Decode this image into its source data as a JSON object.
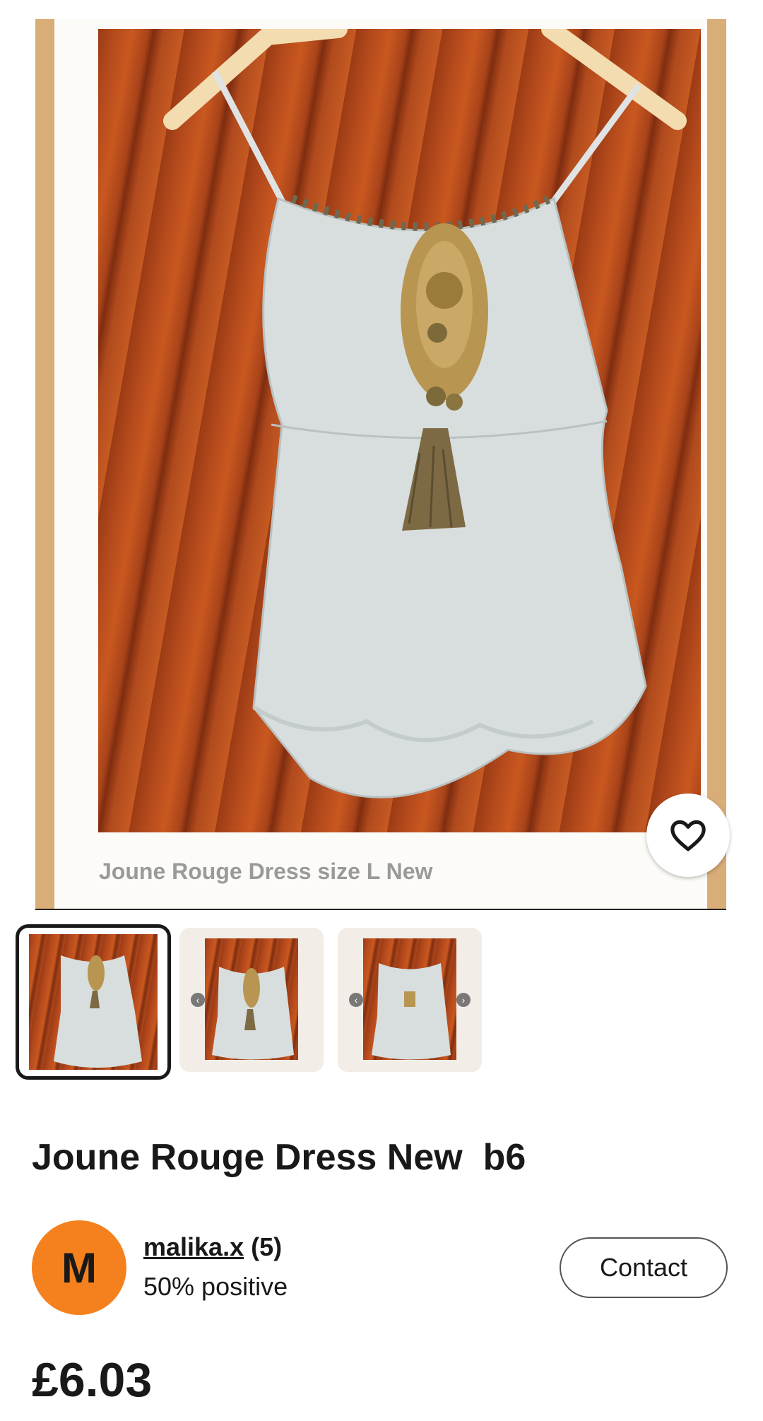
{
  "listing": {
    "image_caption": "Joune Rouge Dress size L New",
    "title": "Joune Rouge Dress New  b6",
    "price": "£6.03"
  },
  "gallery": {
    "image_count": 3,
    "selected_index": 0
  },
  "seller": {
    "avatar_initial": "M",
    "name": "malika.x",
    "score": "(5)",
    "feedback": "50% positive",
    "avatar_color": "#f5811e"
  },
  "actions": {
    "contact_label": "Contact",
    "favorite_icon": "heart-outline-icon"
  }
}
